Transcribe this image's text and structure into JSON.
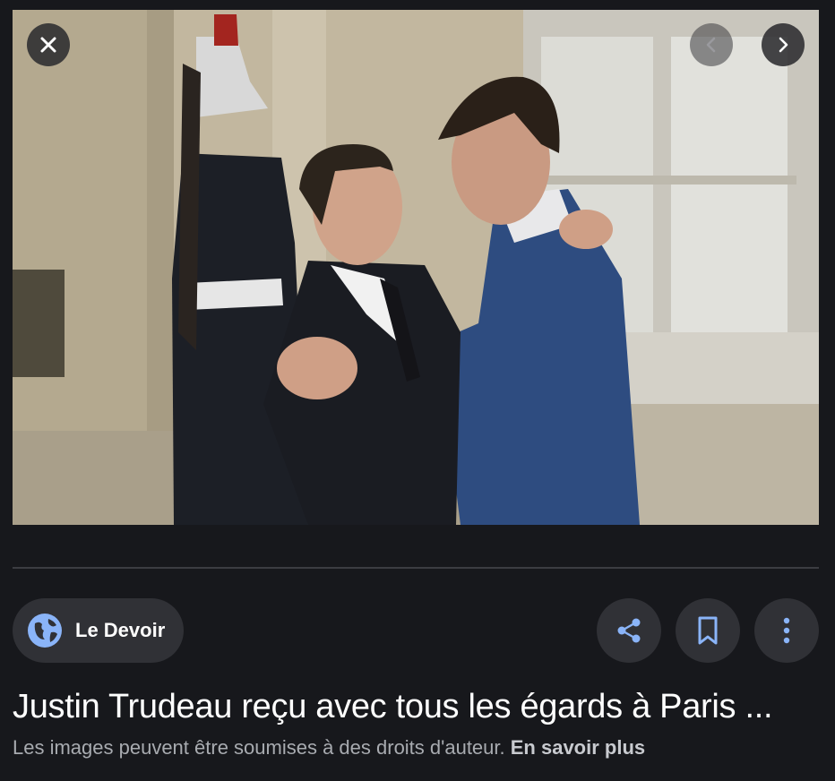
{
  "image": {
    "alt": "Justin Trudeau reçu avec tous les égards à Paris"
  },
  "viewer": {
    "close_icon": "close-icon",
    "prev_icon": "chevron-left-icon",
    "next_icon": "chevron-right-icon"
  },
  "source": {
    "name": "Le Devoir",
    "icon": "globe-icon"
  },
  "actions": {
    "share_icon": "share-icon",
    "save_icon": "bookmark-icon",
    "more_icon": "more-vert-icon"
  },
  "title": "Justin Trudeau reçu avec tous les égards à Paris ...",
  "copyright": {
    "text": "Les images peuvent être soumises à des droits d'auteur.",
    "link": "En savoir plus"
  },
  "colors": {
    "background": "#17181c",
    "chip": "#303136",
    "accent": "#8ab4f8",
    "text": "#ffffff",
    "muted": "#a8abb0"
  }
}
